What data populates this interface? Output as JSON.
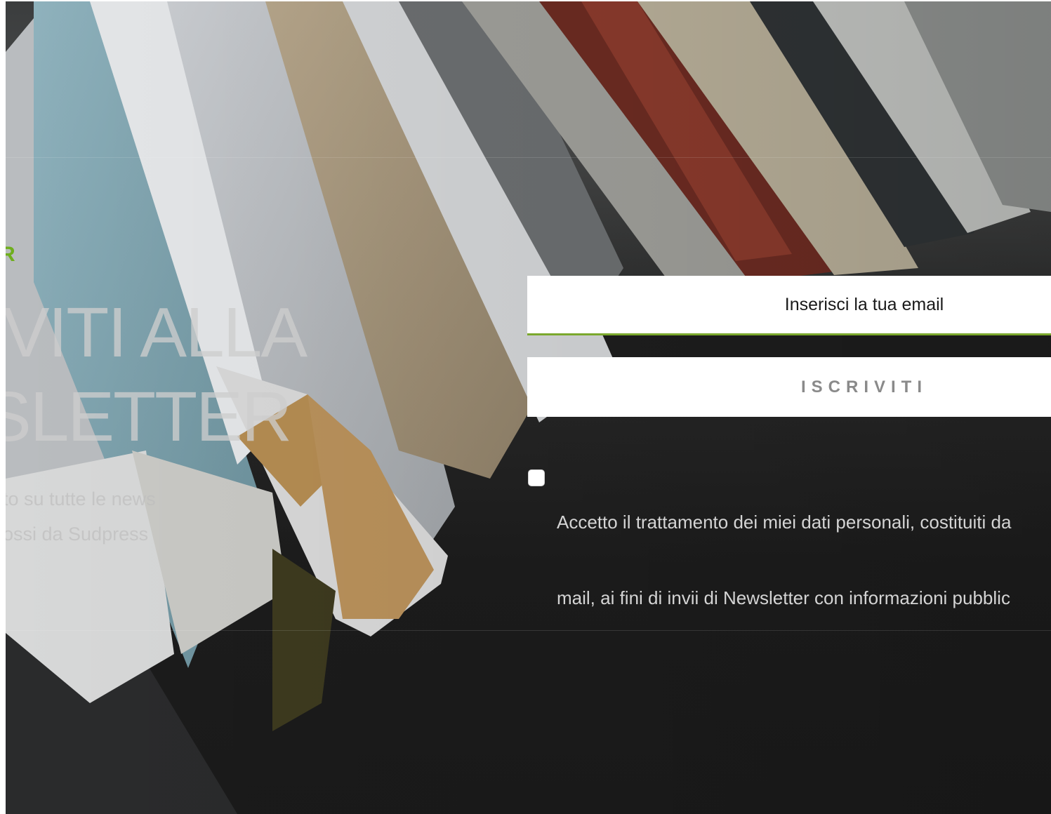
{
  "section": {
    "kicker": "R",
    "title_line_1": "IVITI ALLA",
    "title_line_2": "SLETTER",
    "subtitle_line_1": "to su tutte le news",
    "subtitle_line_2": "ossi da Sudpress"
  },
  "form": {
    "email_placeholder": "Inserisci la tua email",
    "submit_label": "ISCRIVITI",
    "consent_line_1": "Accetto il trattamento dei miei dati personali, costituiti da",
    "consent_line_2": "mail, ai fini di invii di Newsletter con informazioni pubblic"
  },
  "colors": {
    "accent": "#6fae1d",
    "input_underline": "#7ba82d",
    "background_dark": "#1d1d1d"
  }
}
